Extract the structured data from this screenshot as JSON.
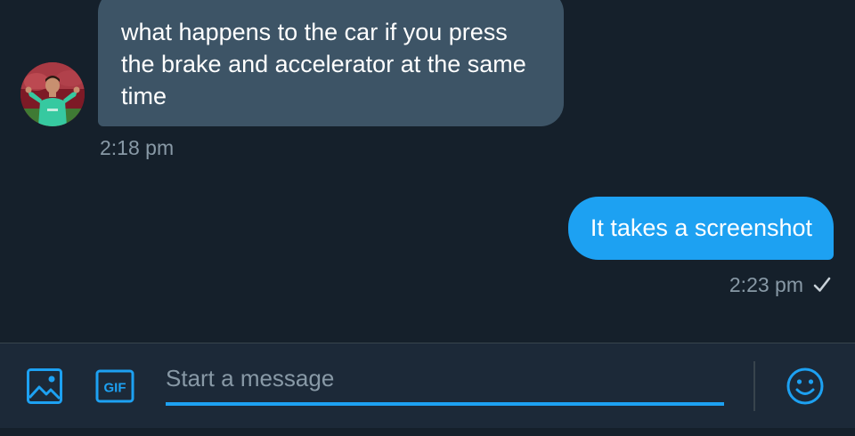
{
  "conversation": {
    "messages": [
      {
        "direction": "incoming",
        "text_lines": [
          "what happens to the car if you press",
          "the brake and accelerator at the same",
          "time"
        ],
        "time": "2:18 pm"
      },
      {
        "direction": "outgoing",
        "text": "It takes a screenshot",
        "time": "2:23 pm",
        "status_icon": "check-icon"
      }
    ]
  },
  "composer": {
    "placeholder": "Start a message",
    "value": "",
    "media_icon": "image-icon",
    "gif_label": "GIF",
    "emoji_icon": "emoji-icon"
  },
  "colors": {
    "background": "#15202b",
    "incoming_bubble": "#3d5466",
    "outgoing_bubble": "#1da1f2",
    "accent": "#1da1f2",
    "muted_text": "#8899a6",
    "composer_bg": "#1c2938"
  }
}
